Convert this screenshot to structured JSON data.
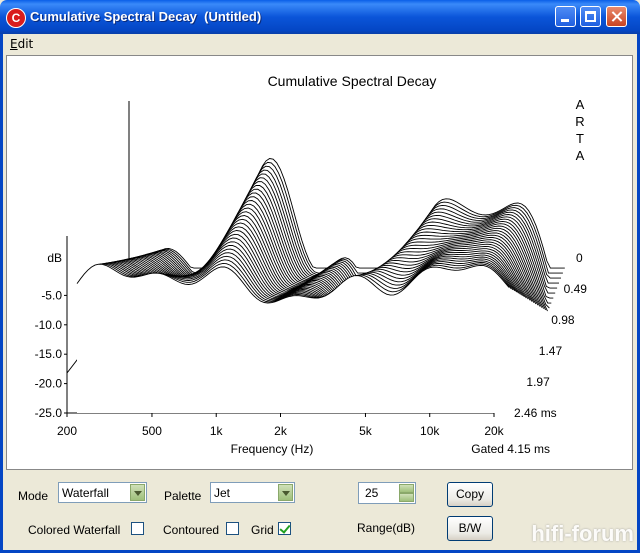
{
  "window": {
    "title": "Cumulative Spectral Decay  (Untitled)",
    "icon_letter": "C"
  },
  "menu": {
    "items": [
      "Edit"
    ]
  },
  "chart_data": {
    "type": "waterfall",
    "title": "Cumulative Spectral Decay",
    "brand": [
      "A",
      "R",
      "T",
      "A"
    ],
    "ylabel": "dB",
    "xlabel": "Frequency (Hz)",
    "zlabel_note": "Gated 4.15 ms",
    "y_ticks": [
      "-5.0",
      "-10.0",
      "-15.0",
      "-20.0",
      "-25.0"
    ],
    "ylim": [
      -25,
      0
    ],
    "x_ticks": [
      "200",
      "500",
      "1k",
      "2k",
      "5k",
      "10k",
      "20k"
    ],
    "x_tick_values": [
      200,
      500,
      1000,
      2000,
      5000,
      10000,
      20000
    ],
    "xlim": [
      200,
      20000
    ],
    "time_ticks": [
      "0",
      "0.49",
      "0.98",
      "1.47",
      "1.97",
      "2.46 ms"
    ],
    "time_range_ms": [
      0,
      2.46
    ],
    "slices": 30,
    "grid": true,
    "palette": "Jet",
    "mode": "Waterfall"
  },
  "controls": {
    "mode_label": "Mode",
    "mode_value": "Waterfall",
    "palette_label": "Palette",
    "palette_value": "Jet",
    "range_value": "25",
    "range_label": "Range(dB)",
    "copy_button": "Copy",
    "bw_button": "B/W",
    "colored_waterfall_label": "Colored Waterfall",
    "colored_waterfall_checked": false,
    "contoured_label": "Contoured",
    "contoured_checked": false,
    "grid_label": "Grid",
    "grid_checked": true
  },
  "watermark": "hifi-forum"
}
